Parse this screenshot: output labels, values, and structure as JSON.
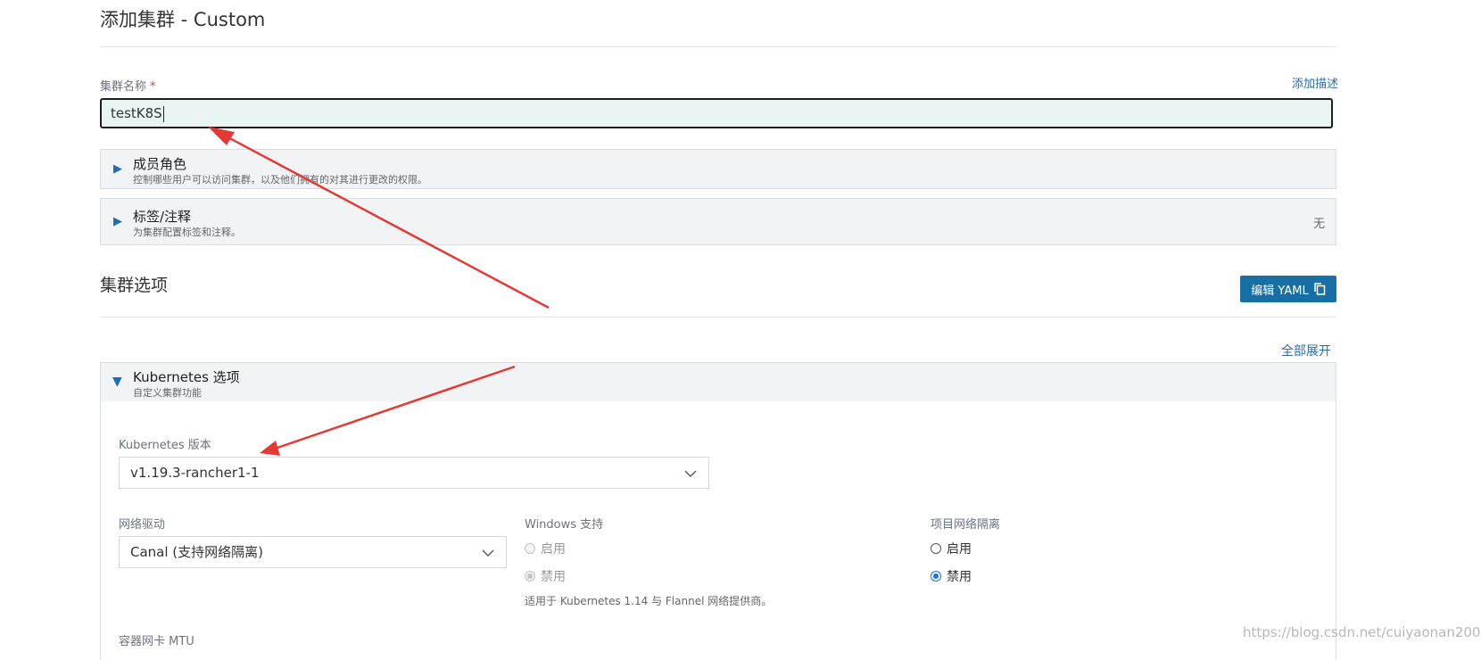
{
  "header": {
    "title": "添加集群 - Custom"
  },
  "cluster_name": {
    "label": "集群名称",
    "required_mark": "*",
    "add_description": "添加描述",
    "value": "testK8S"
  },
  "member_roles": {
    "title": "成员角色",
    "subtitle": "控制哪些用户可以访问集群，以及他们拥有的对其进行更改的权限。"
  },
  "labels": {
    "title": "标签/注释",
    "subtitle": "为集群配置标签和注释。",
    "value": "无"
  },
  "cluster_options": {
    "title": "集群选项",
    "edit_yaml": "编辑 YAML",
    "expand_all": "全部展开"
  },
  "k8s_options": {
    "title": "Kubernetes 选项",
    "subtitle": "自定义集群功能",
    "version_label": "Kubernetes 版本",
    "version_value": "v1.19.3-rancher1-1",
    "network_label": "网络驱动",
    "network_value": "Canal (支持网络隔离)",
    "windows_label": "Windows 支持",
    "windows_enable": "启用",
    "windows_disable": "禁用",
    "windows_note": "适用于 Kubernetes 1.14 与 Flannel 网络提供商。",
    "isolation_label": "项目网络隔离",
    "isolation_enable": "启用",
    "isolation_disable": "禁用",
    "mtu_label": "容器网卡 MTU"
  },
  "watermark": "https://blog.csdn.net/cuiyaonan2000",
  "colors": {
    "accent": "#1670a6",
    "arrow": "#e53935",
    "input_bg": "#e8f5f3"
  }
}
